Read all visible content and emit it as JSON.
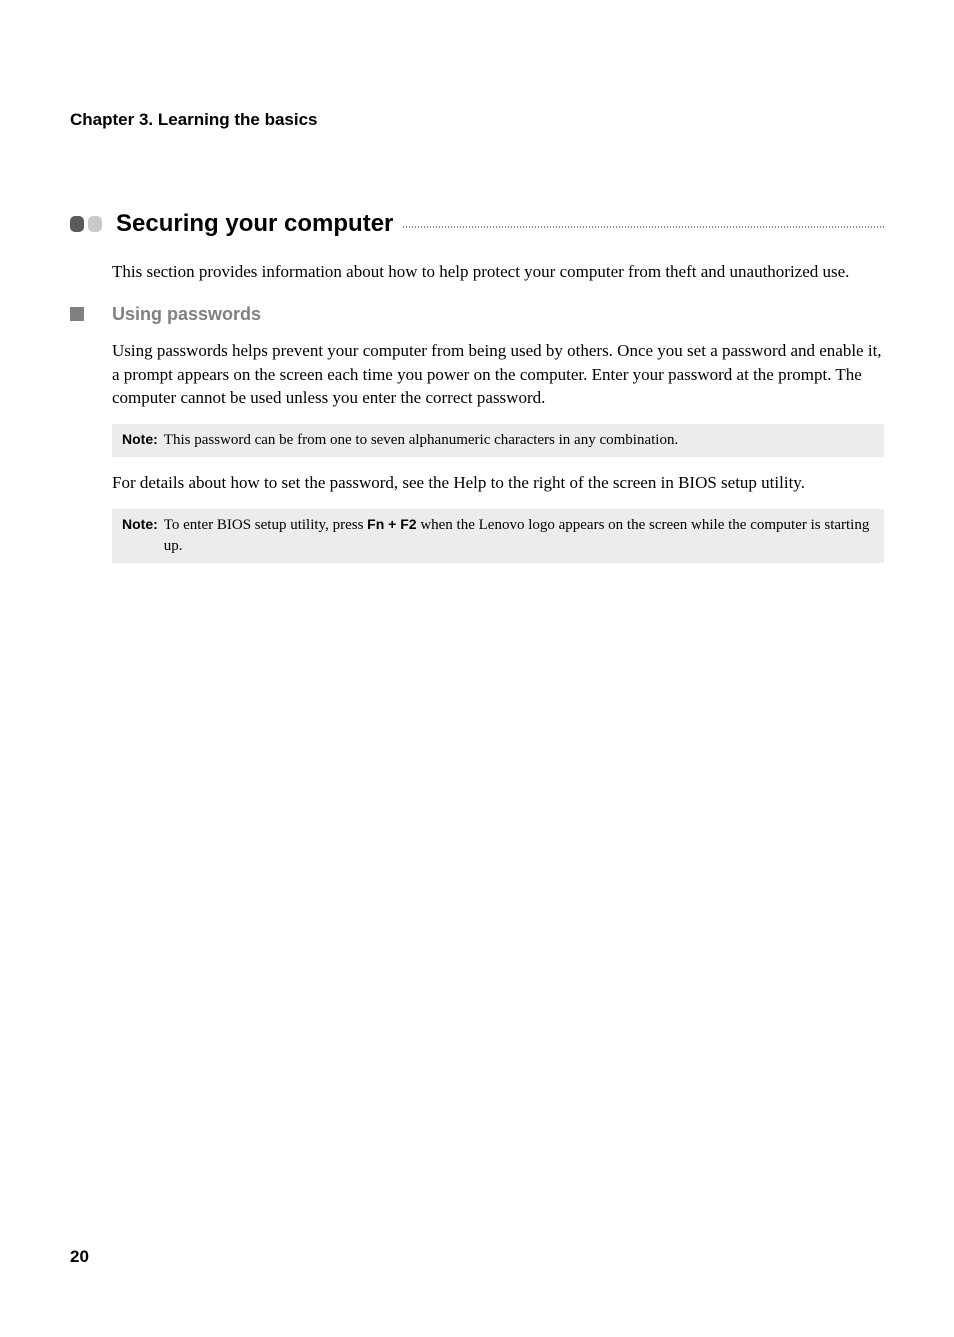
{
  "chapter_header": "Chapter 3. Learning the basics",
  "section_title": "Securing your computer",
  "intro_para": "This section provides information about how to help protect your computer from theft and unauthorized use.",
  "subsection_title": "Using passwords",
  "body_para_1": "Using passwords helps prevent your computer from being used by others. Once you set a password and enable it, a prompt appears on the screen each time you power on the computer. Enter your password at the prompt. The computer cannot be used unless you enter the correct password.",
  "note1_label": "Note:",
  "note1_text": "This password can be from one to seven alphanumeric characters in any combination.",
  "body_para_2": "For details about how to set the password, see the Help to the right of the screen in BIOS setup utility.",
  "note2_label": "Note:",
  "note2_text_a": "To enter BIOS setup utility, press ",
  "note2_bold": "Fn + F2",
  "note2_text_b": " when the Lenovo logo appears on the screen while the computer is starting up.",
  "page_number": "20"
}
